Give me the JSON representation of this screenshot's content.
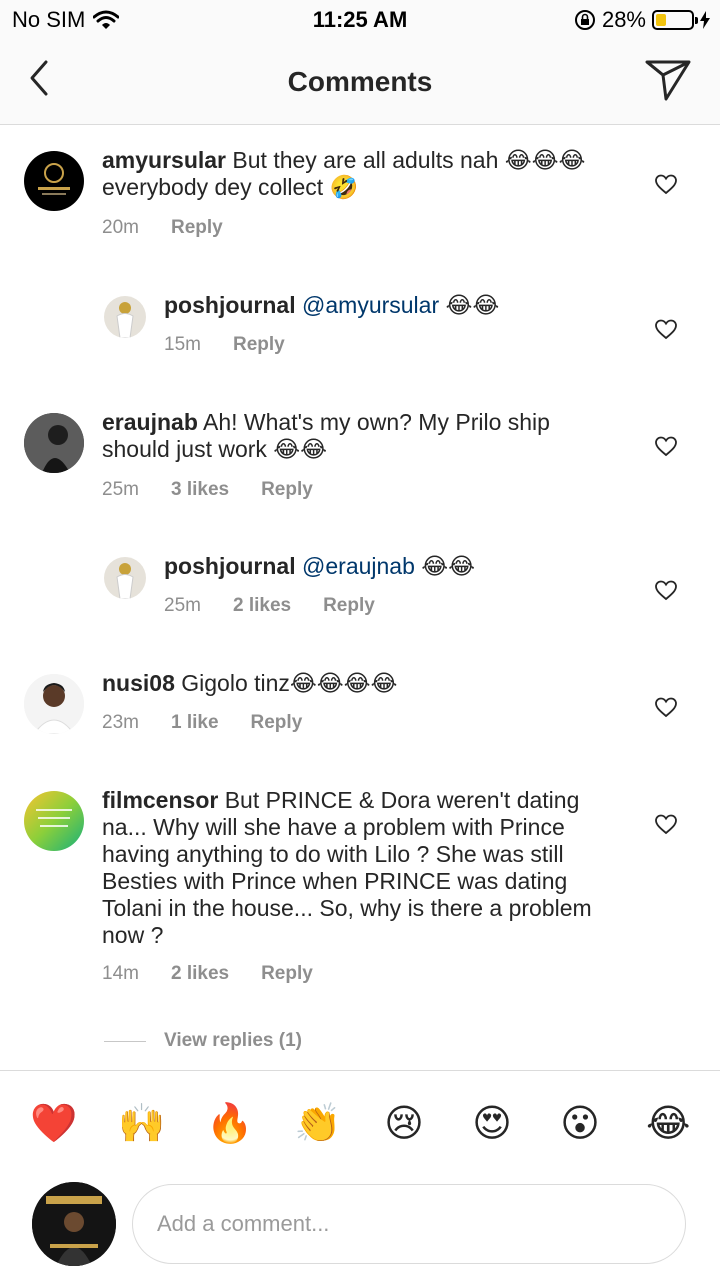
{
  "status_bar": {
    "carrier": "No SIM",
    "time": "11:25 AM",
    "battery_percent": "28%",
    "battery_level": 0.28
  },
  "header": {
    "title": "Comments"
  },
  "comments": [
    {
      "username": "amyursular",
      "text": "But they are all adults nah 😂😂😂everybody dey collect 🤣",
      "time": "20m",
      "likes": "",
      "reply": "Reply"
    },
    {
      "username": "poshjournal",
      "mention": "@amyursular",
      "text": " 😂😂",
      "time": "15m",
      "likes": "",
      "reply": "Reply"
    },
    {
      "username": "eraujnab",
      "text": "Ah! What's my own? My Prilo ship should just work 😂😂",
      "time": "25m",
      "likes": "3 likes",
      "reply": "Reply"
    },
    {
      "username": "poshjournal",
      "mention": "@eraujnab",
      "text": " 😂😂",
      "time": "25m",
      "likes": "2 likes",
      "reply": "Reply"
    },
    {
      "username": "nusi08",
      "text": "Gigolo tinz😂😂😂😂",
      "time": "23m",
      "likes": "1 like",
      "reply": "Reply"
    },
    {
      "username": "filmcensor",
      "text": "But PRINCE & Dora weren't dating na... Why will she have a problem with Prince having anything to do with Lilo ? She was still Besties with Prince when PRINCE was dating Tolani in the house... So, why is there a problem now ?",
      "time": "14m",
      "likes": "2 likes",
      "reply": "Reply"
    }
  ],
  "view_replies": "View replies (1)",
  "emoji_bar": [
    "❤️",
    "🙌",
    "🔥",
    "👏",
    "😢",
    "😍",
    "😮",
    "😂"
  ],
  "composer": {
    "placeholder": "Add a comment..."
  },
  "colors": {
    "text": "#262626",
    "meta": "#8e8e8e",
    "mention": "#00376b",
    "divider": "#dbdbdb",
    "battery": "#f2c40f"
  }
}
